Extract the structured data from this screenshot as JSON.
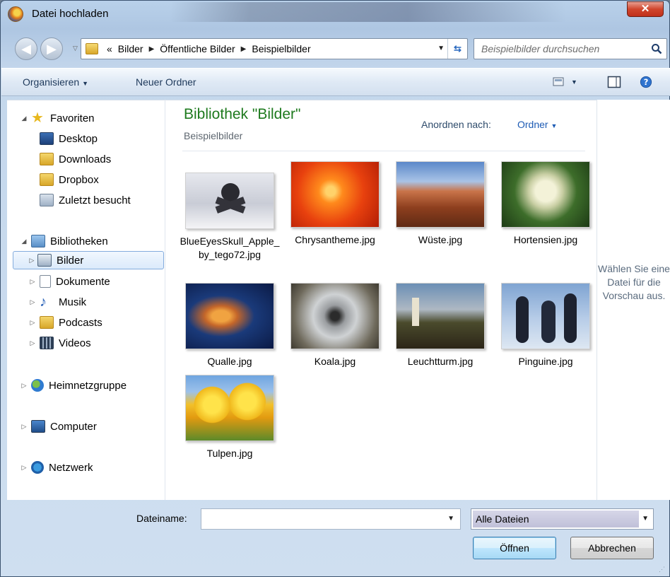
{
  "window": {
    "title": "Datei hochladen"
  },
  "address": {
    "overflow": "«",
    "crumbs": [
      "Bilder",
      "Öffentliche Bilder",
      "Beispielbilder"
    ]
  },
  "search": {
    "placeholder": "Beispielbilder durchsuchen"
  },
  "toolbar": {
    "organize": "Organisieren",
    "new_folder": "Neuer Ordner"
  },
  "nav": {
    "favorites": {
      "label": "Favoriten",
      "items": [
        "Desktop",
        "Downloads",
        "Dropbox",
        "Zuletzt besucht"
      ]
    },
    "libraries": {
      "label": "Bibliotheken",
      "items": [
        "Bilder",
        "Dokumente",
        "Musik",
        "Podcasts",
        "Videos"
      ],
      "selected": "Bilder"
    },
    "homegroup": "Heimnetzgruppe",
    "computer": "Computer",
    "network": "Netzwerk"
  },
  "main": {
    "title": "Bibliothek \"Bilder\"",
    "subtitle": "Beispielbilder",
    "arrange_label": "Anordnen nach:",
    "arrange_value": "Ordner",
    "files": [
      "BlueEyesSkull_Apple_by_tego72.jpg",
      "Chrysantheme.jpg",
      "Wüste.jpg",
      "Hortensien.jpg",
      "Qualle.jpg",
      "Koala.jpg",
      "Leuchtturm.jpg",
      "Pinguine.jpg",
      "Tulpen.jpg"
    ]
  },
  "preview": {
    "text": "Wählen Sie eine Datei für die Vorschau aus."
  },
  "footer": {
    "filename_label": "Dateiname:",
    "filename_value": "",
    "filetype": "Alle Dateien",
    "open": "Öffnen",
    "cancel": "Abbrechen"
  },
  "colors": {
    "library_title": "#1e7a1e",
    "link_blue": "#1d5bb4",
    "selection_border": "#84acdd"
  }
}
